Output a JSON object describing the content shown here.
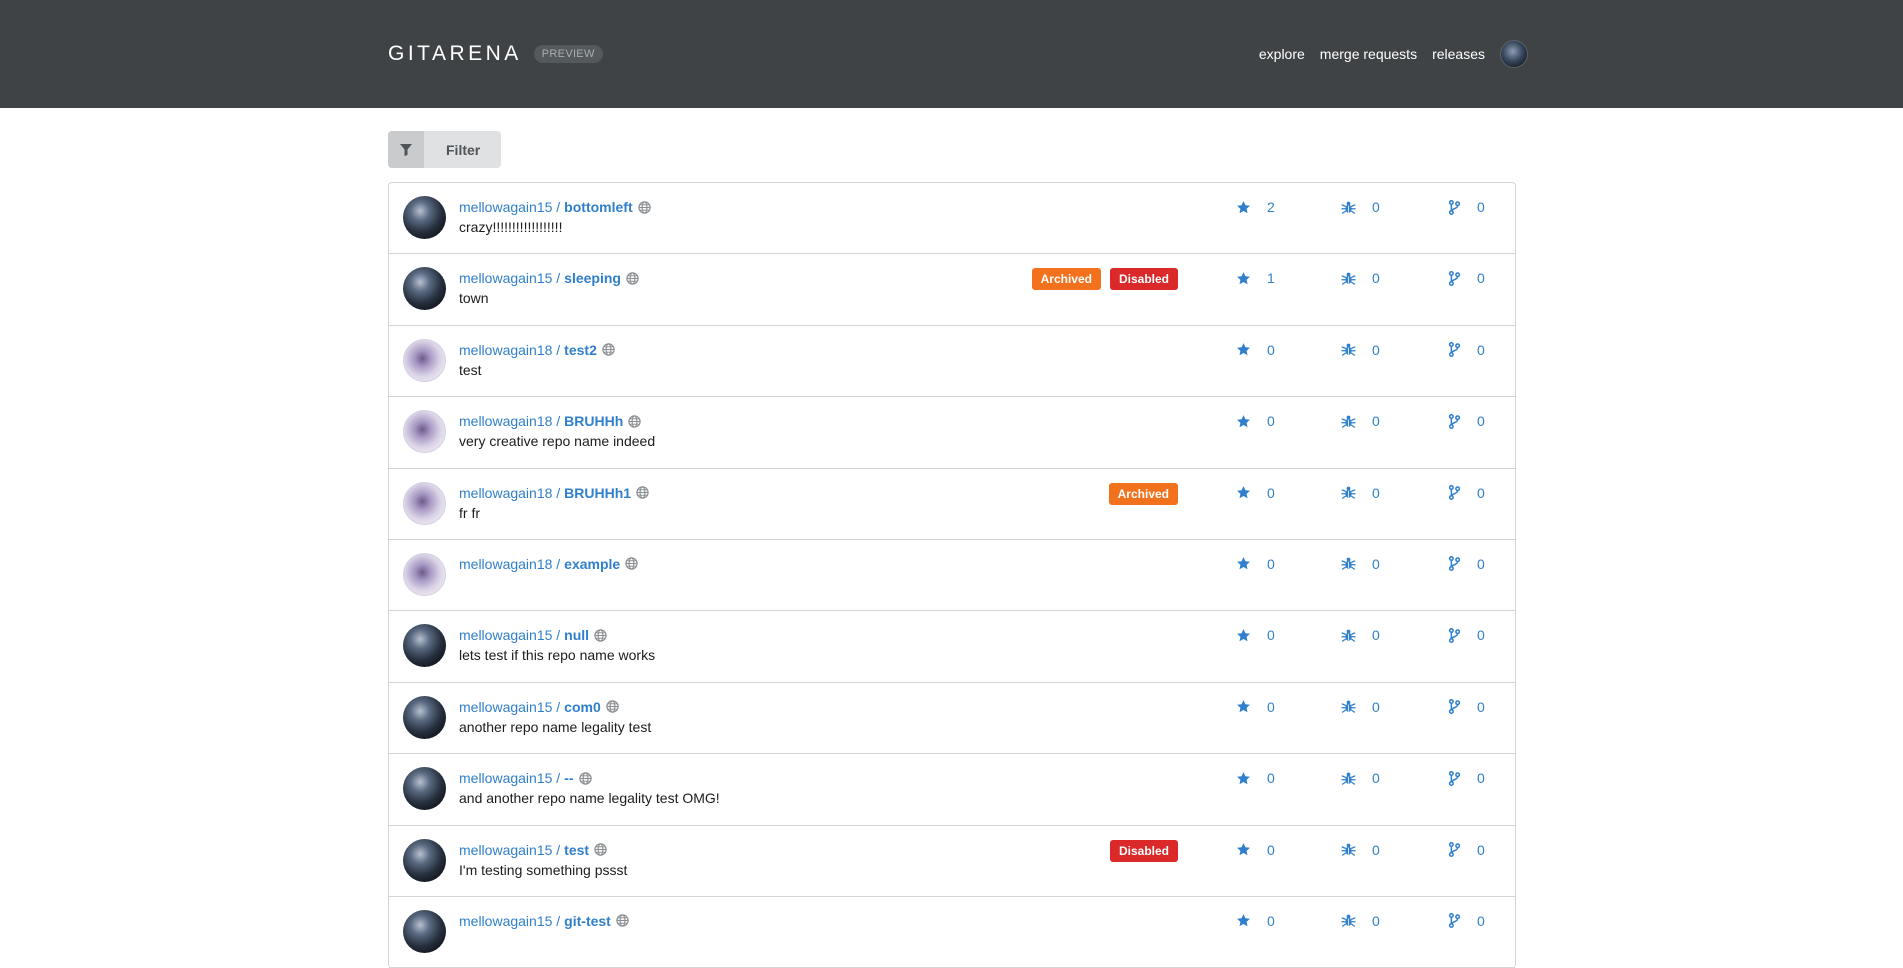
{
  "header": {
    "brand": "GITARENA",
    "badge": "PREVIEW",
    "nav": [
      "explore",
      "merge requests",
      "releases"
    ]
  },
  "toolbar": {
    "filter_label": "Filter"
  },
  "icons": {
    "filter": "filter-icon",
    "globe": "globe-icon",
    "star": "star-icon",
    "issue": "bug-icon",
    "merge": "merge-icon"
  },
  "colors": {
    "link": "#2f7fcc",
    "archived": "#f2711c",
    "disabled": "#db2828",
    "header_bg": "#3f4345"
  },
  "repos": [
    {
      "owner": "mellowagain15 /",
      "name": "bottomleft",
      "desc": "crazy!!!!!!!!!!!!!!!!!!",
      "archived": false,
      "disabled": false,
      "stars": "2",
      "issues": "0",
      "prs": "0",
      "avatar": "dark"
    },
    {
      "owner": "mellowagain15 /",
      "name": "sleeping",
      "desc": "town",
      "archived": true,
      "disabled": true,
      "stars": "1",
      "issues": "0",
      "prs": "0",
      "avatar": "dark"
    },
    {
      "owner": "mellowagain18 /",
      "name": "test2",
      "desc": "test",
      "archived": false,
      "disabled": false,
      "stars": "0",
      "issues": "0",
      "prs": "0",
      "avatar": "light"
    },
    {
      "owner": "mellowagain18 /",
      "name": "BRUHHh",
      "desc": "very creative repo name indeed",
      "archived": false,
      "disabled": false,
      "stars": "0",
      "issues": "0",
      "prs": "0",
      "avatar": "light"
    },
    {
      "owner": "mellowagain18 /",
      "name": "BRUHHh1",
      "desc": "fr fr",
      "archived": true,
      "disabled": false,
      "stars": "0",
      "issues": "0",
      "prs": "0",
      "avatar": "light"
    },
    {
      "owner": "mellowagain18 /",
      "name": "example",
      "desc": "",
      "archived": false,
      "disabled": false,
      "stars": "0",
      "issues": "0",
      "prs": "0",
      "avatar": "light"
    },
    {
      "owner": "mellowagain15 /",
      "name": "null",
      "desc": "lets test if this repo name works",
      "archived": false,
      "disabled": false,
      "stars": "0",
      "issues": "0",
      "prs": "0",
      "avatar": "dark"
    },
    {
      "owner": "mellowagain15 /",
      "name": "com0",
      "desc": "another repo name legality test",
      "archived": false,
      "disabled": false,
      "stars": "0",
      "issues": "0",
      "prs": "0",
      "avatar": "dark"
    },
    {
      "owner": "mellowagain15 /",
      "name": "--",
      "desc": "and another repo name legality test OMG!",
      "archived": false,
      "disabled": false,
      "stars": "0",
      "issues": "0",
      "prs": "0",
      "avatar": "dark"
    },
    {
      "owner": "mellowagain15 /",
      "name": "test",
      "desc": "I'm testing something pssst",
      "archived": false,
      "disabled": true,
      "stars": "0",
      "issues": "0",
      "prs": "0",
      "avatar": "dark"
    },
    {
      "owner": "mellowagain15 /",
      "name": "git-test",
      "desc": "",
      "archived": false,
      "disabled": false,
      "stars": "0",
      "issues": "0",
      "prs": "0",
      "avatar": "dark"
    }
  ],
  "badge_labels": {
    "archived": "Archived",
    "disabled": "Disabled"
  }
}
